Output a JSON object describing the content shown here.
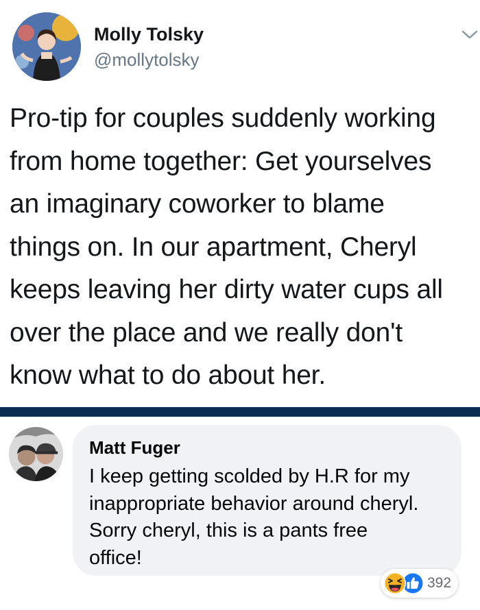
{
  "tweet": {
    "author_name": "Molly Tolsky",
    "author_handle": "@mollytolsky",
    "text_lines": [
      "Pro-tip for couples suddenly working",
      "from home together: Get yourselves",
      "an imaginary coworker to blame",
      "things on. In our apartment, Cheryl",
      "keeps leaving her dirty water cups all",
      "over the place and we really don't",
      "know what to do about her."
    ]
  },
  "comment": {
    "author_name": "Matt Fuger",
    "text_lines": [
      "I keep getting scolded by H.R for my",
      "inappropriate behavior around cheryl.",
      "Sorry cheryl, this is a pants free",
      "office!"
    ],
    "reactions": {
      "icons": [
        "haha-icon",
        "like-icon"
      ],
      "count": "392"
    }
  },
  "colors": {
    "divider": "#0d2c54",
    "handle_gray": "#657786",
    "bubble_bg": "#f0f2f5",
    "like_blue": "#1877f2",
    "haha_yellow": "#f7b125"
  }
}
